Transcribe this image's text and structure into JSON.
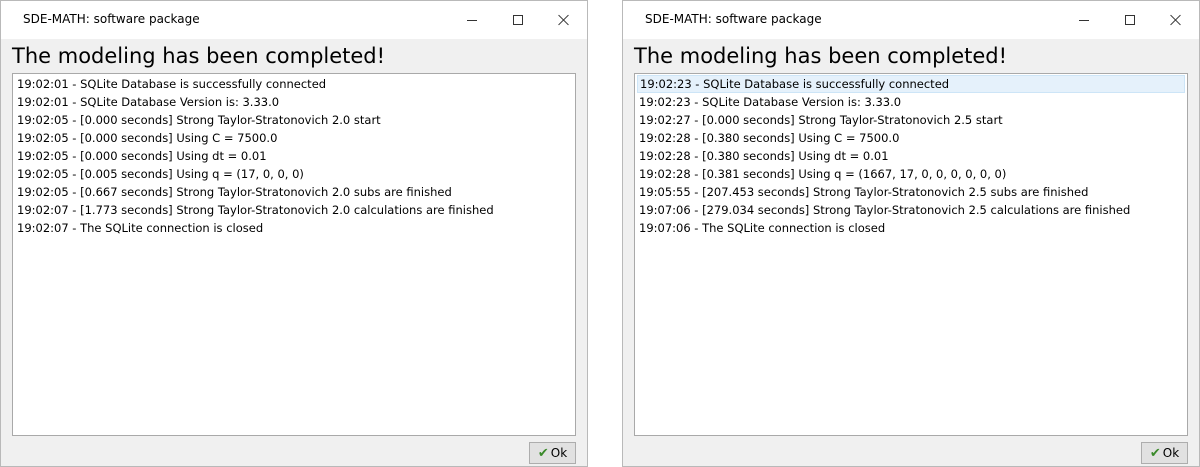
{
  "windows": [
    {
      "title": "SDE-MATH: software package",
      "heading": "The modeling has been completed!",
      "log": [
        "19:02:01 - SQLite Database is successfully connected",
        "19:02:01 - SQLite Database Version is: 3.33.0",
        "19:02:05 - [0.000 seconds] Strong Taylor-Stratonovich 2.0 start",
        "19:02:05 - [0.000 seconds] Using C = 7500.0",
        "19:02:05 - [0.000 seconds] Using dt = 0.01",
        "19:02:05 - [0.005 seconds] Using q = (17, 0, 0, 0)",
        "19:02:05 - [0.667 seconds] Strong Taylor-Stratonovich 2.0 subs are finished",
        "19:02:07 - [1.773 seconds] Strong Taylor-Stratonovich 2.0 calculations are finished",
        "19:02:07 - The SQLite connection is closed"
      ],
      "ok_label": "Ok"
    },
    {
      "title": "SDE-MATH: software package",
      "heading": "The modeling has been completed!",
      "log": [
        "19:02:23 - SQLite Database is successfully connected",
        "19:02:23 - SQLite Database Version is: 3.33.0",
        "19:02:27 - [0.000 seconds] Strong Taylor-Stratonovich 2.5 start",
        "19:02:28 - [0.380 seconds] Using C = 7500.0",
        "19:02:28 - [0.380 seconds] Using dt = 0.01",
        "19:02:28 - [0.381 seconds] Using q = (1667, 17, 0, 0, 0, 0, 0, 0)",
        "19:05:55 - [207.453 seconds] Strong Taylor-Stratonovich 2.5 subs are finished",
        "19:07:06 - [279.034 seconds] Strong Taylor-Stratonovich 2.5 calculations are finished",
        "19:07:06 - The SQLite connection is closed"
      ],
      "ok_label": "Ok"
    }
  ],
  "icons": {
    "ok": "check-icon",
    "minimize": "minimize-icon",
    "maximize": "maximize-icon",
    "close": "close-icon"
  },
  "colors": {
    "selection": "#e5f1fb",
    "check": "#3a8a2a",
    "window_bg": "#f0f0f0"
  }
}
